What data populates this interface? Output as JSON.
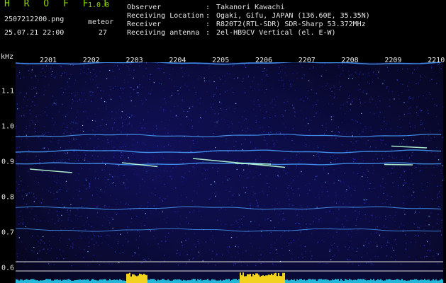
{
  "app": {
    "name": "H R O F F T",
    "version": "1.0.0"
  },
  "left_info": {
    "filename": "2507212200.png",
    "meteor_label": "meteor",
    "datetime": "25.07.21 22:00",
    "meteor_count": "27"
  },
  "station": {
    "rows": [
      {
        "label": "Observer",
        "value": "Takanori Kawachi"
      },
      {
        "label": "Receiving Location",
        "value": "Ogaki, Gifu, JAPAN (136.60E, 35.35N)"
      },
      {
        "label": "Receiver",
        "value": "R820T2(RTL-SDR) SDR-Sharp 53.372MHz"
      },
      {
        "label": "Receiving antenna",
        "value": "2el-HB9CV Vertical (el. E-W)"
      }
    ]
  },
  "colors": {
    "accent": "#8ed400",
    "text": "#e8e8e8",
    "trace": "#4aa0ff",
    "meteor": "#ffffff"
  },
  "chart_data": {
    "type": "heatmap",
    "yunit": "kHz",
    "x_ticks": [
      "2201",
      "2202",
      "2203",
      "2204",
      "2205",
      "2206",
      "2207",
      "2208",
      "2209",
      "2210"
    ],
    "y_ticks": [
      "1.1",
      "1.0",
      "0.9",
      "0.8",
      "0.7",
      "0.6"
    ],
    "ylim": [
      0.6,
      1.15
    ],
    "xlim": [
      2200,
      2210
    ]
  }
}
